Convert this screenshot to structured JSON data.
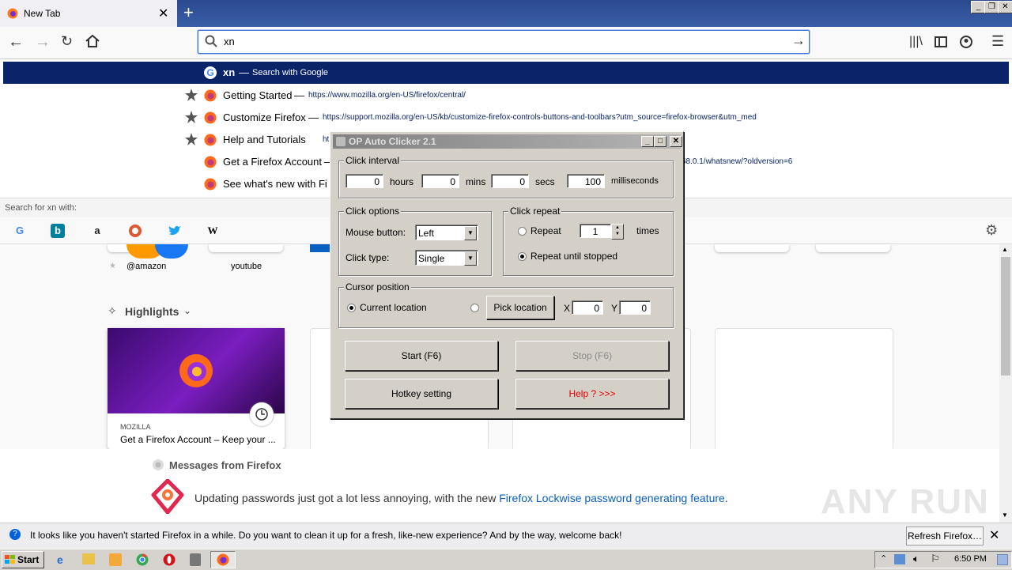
{
  "browser": {
    "tab_title": "New Tab",
    "new_tab_symbol": "+",
    "url_value": "xn",
    "suggestions": [
      {
        "title": "xn",
        "sep": "—",
        "url": "Search with Google",
        "selected": true
      },
      {
        "title": "Getting Started",
        "sep": "—",
        "url": "https://www.mozilla.org/en-US/firefox/central/"
      },
      {
        "title": "Customize Firefox",
        "sep": "—",
        "url": "https://support.mozilla.org/en-US/kb/customize-firefox-controls-buttons-and-toolbars?utm_source=firefox-browser&utm_med"
      },
      {
        "title": "Help and Tutorials",
        "sep": "—",
        "url": "ht"
      },
      {
        "title": "Get a Firefox Account",
        "sep": "—",
        "url": "68.0.1/whatsnew/?oldversion=6"
      },
      {
        "title": "See what's new with Fi",
        "sep": "",
        "url": ""
      }
    ],
    "search_for_label": "Search for xn with:",
    "engines": [
      "G",
      "b",
      "a",
      "",
      "",
      "W"
    ]
  },
  "newtab": {
    "shortcuts": [
      {
        "label": "@amazon"
      },
      {
        "label": "youtube"
      }
    ],
    "highlights_label": "Highlights",
    "card_source": "MOZILLA",
    "card_title": "Get a Firefox Account – Keep your ...",
    "messages_label": "Messages from Firefox",
    "message_text": "Updating passwords just got a lot less annoying, with the new ",
    "message_link": "Firefox Lockwise password generating feature",
    "message_end": ".",
    "watermark": "ANY RUN"
  },
  "notification": {
    "text": "It looks like you haven't started Firefox in a while. Do you want to clean it up for a fresh, like-new experience? And by the way, welcome back!",
    "button": "Refresh Firefox…"
  },
  "taskbar": {
    "start_label": "Start",
    "clock": "6:50 PM"
  },
  "dialog": {
    "title": "OP Auto Clicker 2.1",
    "click_interval": {
      "label": "Click interval",
      "hours": "0",
      "hours_label": "hours",
      "mins": "0",
      "mins_label": "mins",
      "secs": "0",
      "secs_label": "secs",
      "ms": "100",
      "ms_label": "milliseconds"
    },
    "click_options": {
      "label": "Click options",
      "mouse_button_label": "Mouse button:",
      "mouse_button_value": "Left",
      "click_type_label": "Click type:",
      "click_type_value": "Single"
    },
    "click_repeat": {
      "label": "Click repeat",
      "repeat_label": "Repeat",
      "repeat_value": "1",
      "times_label": "times",
      "until_stopped_label": "Repeat until stopped"
    },
    "cursor_position": {
      "label": "Cursor position",
      "current_label": "Current location",
      "pick_button": "Pick location",
      "x_label": "X",
      "x_value": "0",
      "y_label": "Y",
      "y_value": "0"
    },
    "buttons": {
      "start": "Start (F6)",
      "stop": "Stop (F6)",
      "hotkey": "Hotkey setting",
      "help": "Help ? >>>"
    }
  },
  "colors": {
    "selection": "#0b2469",
    "accent": "#3a73d1",
    "help_red": "#e00000",
    "link": "#0a60c0"
  }
}
